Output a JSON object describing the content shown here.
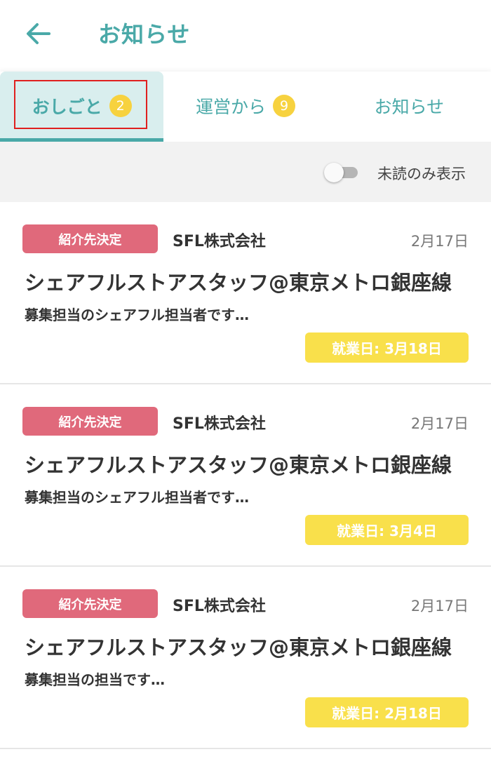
{
  "header": {
    "title": "お知らせ",
    "back_icon": "arrow-left-icon",
    "accent_color": "#4aa9a8"
  },
  "tabs": [
    {
      "label": "おしごと",
      "badge": "2",
      "active": true
    },
    {
      "label": "運営から",
      "badge": "9",
      "active": false
    },
    {
      "label": "お知らせ",
      "badge": "",
      "active": false
    }
  ],
  "filter": {
    "label": "未読のみ表示",
    "toggle_on": false
  },
  "notifications": [
    {
      "status": "紹介先決定",
      "company": "SFL株式会社",
      "date": "2月17日",
      "title": "シェアフルストアスタッフ@東京メトロ銀座線",
      "snippet": "募集担当のシェアフル担当者です…",
      "work_date": "就業日: 3月18日"
    },
    {
      "status": "紹介先決定",
      "company": "SFL株式会社",
      "date": "2月17日",
      "title": "シェアフルストアスタッフ@東京メトロ銀座線",
      "snippet": "募集担当のシェアフル担当者です…",
      "work_date": "就業日: 3月4日"
    },
    {
      "status": "紹介先決定",
      "company": "SFL株式会社",
      "date": "2月17日",
      "title": "シェアフルストアスタッフ@東京メトロ銀座線",
      "snippet": "募集担当の担当です…",
      "work_date": "就業日: 2月18日"
    }
  ],
  "colors": {
    "status_tag": "#e0697b",
    "work_badge": "#f9e04b",
    "badge": "#f7d23f",
    "active_tab_bg": "#d9eeee"
  }
}
